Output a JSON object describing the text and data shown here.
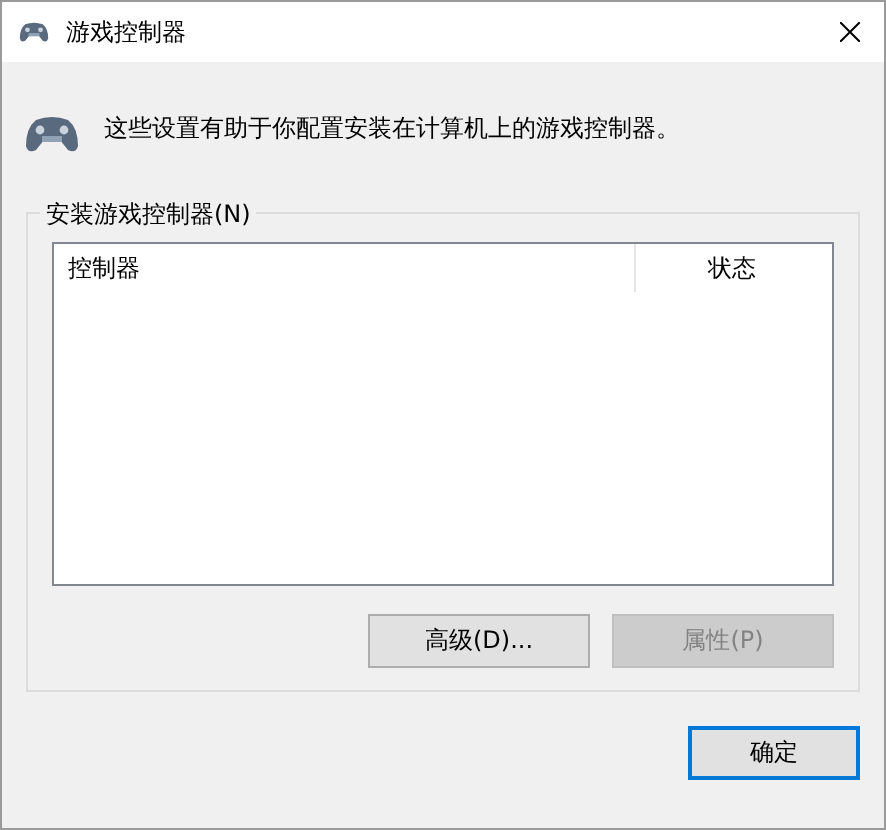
{
  "window": {
    "title": "游戏控制器"
  },
  "description": "这些设置有助于你配置安装在计算机上的游戏控制器。",
  "group": {
    "label": "安装游戏控制器(N)",
    "columns": [
      "控制器",
      "状态"
    ]
  },
  "buttons": [
    {
      "label": "高级(D)...",
      "disabled": false
    },
    {
      "label": "属性(P)",
      "disabled": true
    }
  ],
  "footer_buttons": [
    {
      "label": "确定",
      "default": true
    }
  ]
}
